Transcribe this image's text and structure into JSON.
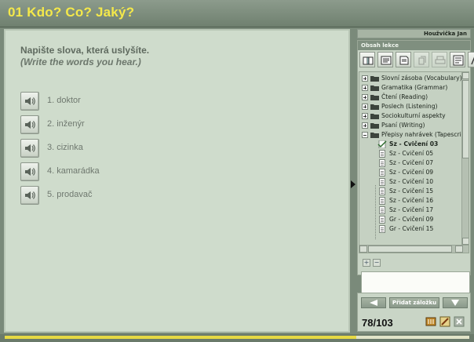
{
  "lesson": {
    "title": "01 Kdo? Co? Jaký?"
  },
  "exercise": {
    "instruction_cz": "Napište slova, která uslyšíte.",
    "instruction_en": "(Write the words you hear.)",
    "words": [
      {
        "label": "1. doktor"
      },
      {
        "label": "2. inženýr"
      },
      {
        "label": "3. cizinka"
      },
      {
        "label": "4. kamarádka"
      },
      {
        "label": "5. prodavač"
      }
    ]
  },
  "sidebar": {
    "user_name": "Houžvička Jan",
    "contents_header": "Obsah lekce",
    "tree": {
      "folders": [
        "Slovní zásoba (Vocabulary)",
        "Gramatika (Grammar)",
        "Čtení (Reading)",
        "Poslech (Listening)",
        "Sociokulturní aspekty",
        "Psaní (Writing)",
        "Přepisy nahrávek (Tapescripts)"
      ],
      "items": [
        "Sz - Cvičení 03",
        "Sz - Cvičení 05",
        "Sz - Cvičení 07",
        "Sz - Cvičení 09",
        "Sz - Cvičení 10",
        "Sz - Cvičení 15",
        "Sz - Cvičení 16",
        "Sz - Cvičení 17",
        "Gr - Cvičení 09",
        "Gr - Cvičení 15"
      ],
      "selected_item": "Sz - Cvičení 03"
    },
    "nav": {
      "bookmark_label": "Přidat záložku",
      "page_counter": "78/103"
    }
  },
  "progress": {
    "current": 78,
    "total": 103
  },
  "colors": {
    "title_text": "#f4e84a",
    "progress_fill": "#e6d944",
    "panel_bg": "#cfdccc"
  }
}
